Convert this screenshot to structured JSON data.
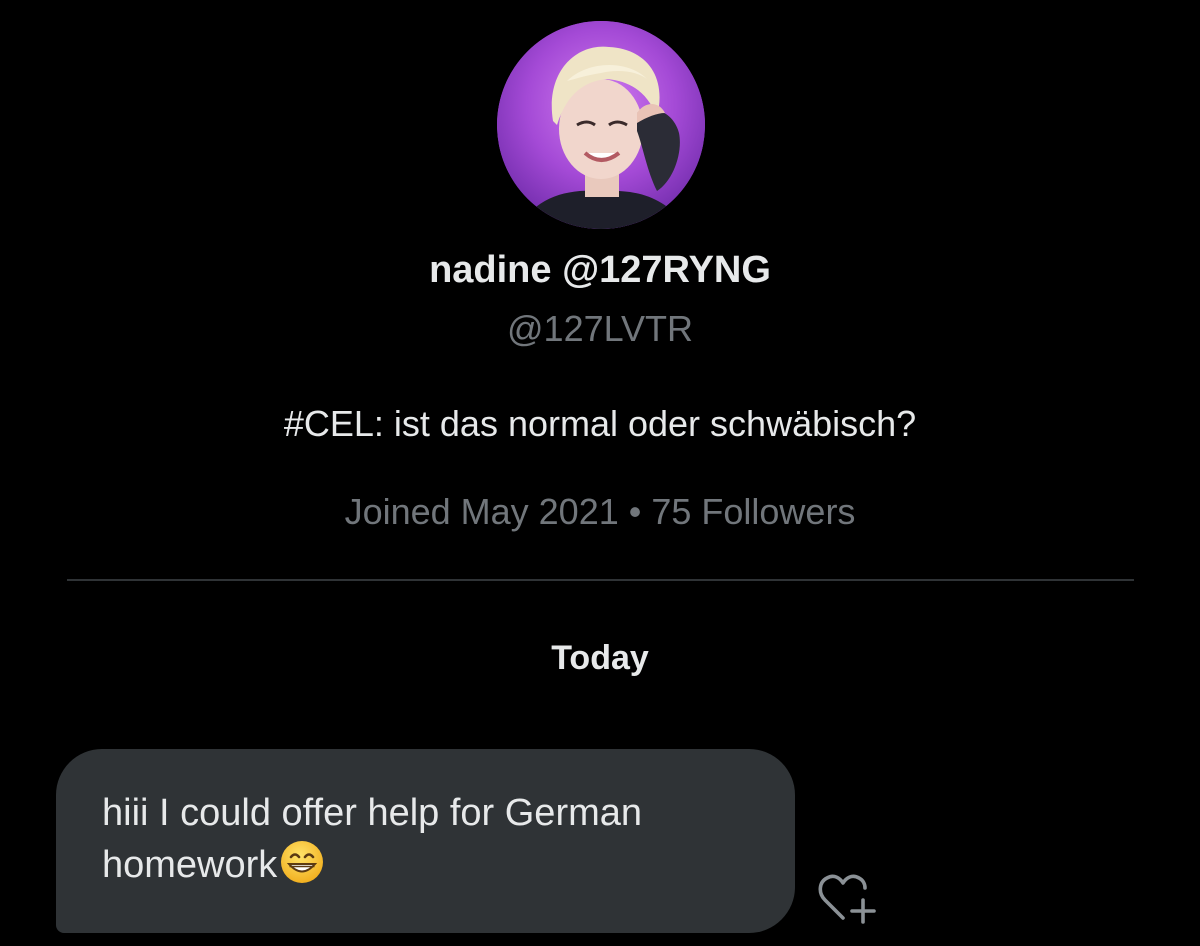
{
  "profile": {
    "avatar_icon": "profile-photo-avatar",
    "display_name": "nadine @127RYNG",
    "handle": "@127LVTR",
    "bio": "#CEL: ist das normal oder schwäbisch?",
    "meta": "Joined May 2021 • 75 Followers"
  },
  "conversation": {
    "date_label": "Today",
    "messages": [
      {
        "text": "hiii I could offer help for German homework",
        "emoji": "grinning-face-with-smiling-eyes"
      }
    ],
    "react_icon": "heart-plus-icon"
  },
  "colors": {
    "background": "#000000",
    "primary_text": "#e7e9ea",
    "secondary_text": "#71767b",
    "bubble": "#2f3336",
    "avatar_accent": "#a649d8"
  }
}
